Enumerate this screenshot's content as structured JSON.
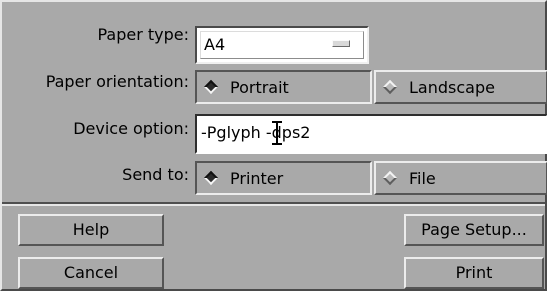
{
  "form": {
    "paper_type": {
      "label": "Paper type:",
      "value": "A4"
    },
    "orientation": {
      "label": "Paper orientation:",
      "options": [
        {
          "label": "Portrait",
          "selected": true
        },
        {
          "label": "Landscape",
          "selected": false
        }
      ]
    },
    "device_option": {
      "label": "Device option:",
      "value": "-Pglyph -dps2"
    },
    "send_to": {
      "label": "Send to:",
      "options": [
        {
          "label": "Printer",
          "selected": true
        },
        {
          "label": "File",
          "selected": false
        }
      ]
    }
  },
  "buttons": {
    "help": "Help",
    "page_setup": "Page Setup...",
    "cancel": "Cancel",
    "print": "Print"
  },
  "icons": {
    "option_menu_indicator": "option-menu-indicator-icon",
    "radio_selected": "radio-diamond-selected-icon",
    "radio_unselected": "radio-diamond-unselected-icon",
    "text_cursor": "ibeam-cursor-icon"
  },
  "colors": {
    "dialog_background": "#a9a9a9",
    "field_background": "#ffffff"
  }
}
